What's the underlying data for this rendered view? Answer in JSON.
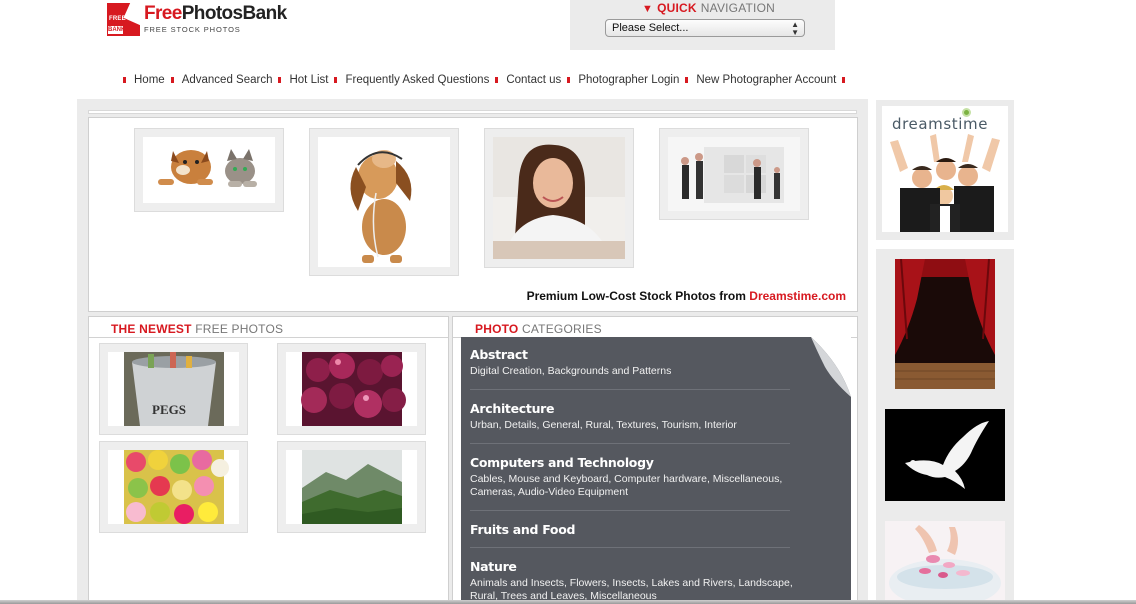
{
  "header": {
    "logo_mark_top": "FREE",
    "logo_mark_bottom": "BANK",
    "logo_name_free": "Free",
    "logo_name_rest": "PhotosBank",
    "tagline": "FREE STOCK PHOTOS"
  },
  "quick_nav": {
    "title_strong": "QUICK",
    "title_rest": "NAVIGATION",
    "select_value": "Please Select..."
  },
  "nav": {
    "items": [
      "Home",
      "Advanced Search",
      "Hot List",
      "Frequently Asked Questions",
      "Contact us",
      "Photographer Login",
      "New Photographer Account"
    ]
  },
  "gallery": {
    "premium_text": "Premium Low-Cost Stock Photos from",
    "premium_link": "Dreamstime.com"
  },
  "newest": {
    "title_strong": "THE NEWEST",
    "title_rest": "FREE PHOTOS"
  },
  "categories": {
    "title_strong": "PHOTO",
    "title_rest": "CATEGORIES",
    "items": [
      {
        "name": "Abstract",
        "desc": "Digital Creation, Backgrounds and Patterns"
      },
      {
        "name": "Architecture",
        "desc": "Urban, Details, General, Rural, Textures, Tourism, Interior"
      },
      {
        "name": "Computers and Technology",
        "desc": "Cables, Mouse and Keyboard, Computer hardware, Miscellaneous, Cameras, Audio-Video Equipment"
      },
      {
        "name": "Fruits and Food",
        "desc": ""
      },
      {
        "name": "Nature",
        "desc": "Animals and Insects, Flowers, Insects, Lakes and Rivers, Landscape, Rural, Trees and Leaves, Miscellaneous"
      }
    ]
  },
  "ad": {
    "brand": "dreamstime"
  },
  "colors": {
    "brand_red": "#d71920",
    "panel_gray": "#ebebeb",
    "category_bg": "#55585f"
  }
}
